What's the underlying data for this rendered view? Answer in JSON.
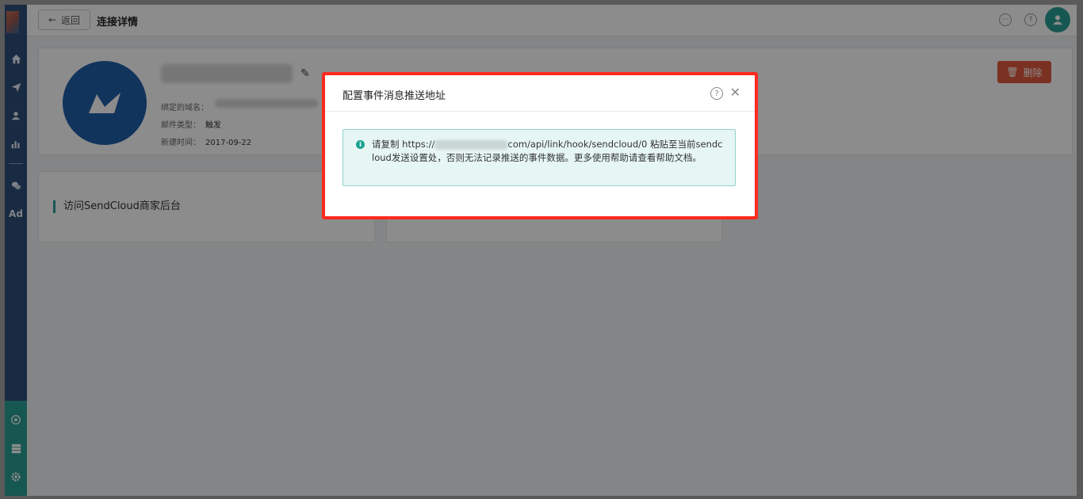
{
  "header": {
    "back_label": "返回",
    "page_title": "连接详情"
  },
  "sidebar": {
    "ad_label": "Ad"
  },
  "connection": {
    "domain_label": "绑定的域名：",
    "mail_type_label": "邮件类型：",
    "mail_type_value": "触发",
    "created_label": "新建时间：",
    "created_value": "2017-09-22",
    "delete_label": "删除"
  },
  "cards": {
    "visit_label": "访问SendCloud商家后台"
  },
  "modal": {
    "title": "配置事件消息推送地址",
    "message_prefix": "请复制 https://",
    "message_suffix": "com/api/link/hook/sendcloud/0 粘贴至当前sendcloud发送设置处，否则无法记录推送的事件数据。更多使用帮助请查看帮助文档。"
  },
  "colors": {
    "accent": "#2a9f94",
    "sidebar": "#2d4f78",
    "danger": "#e05a3d",
    "highlight": "#ff2a1f"
  }
}
